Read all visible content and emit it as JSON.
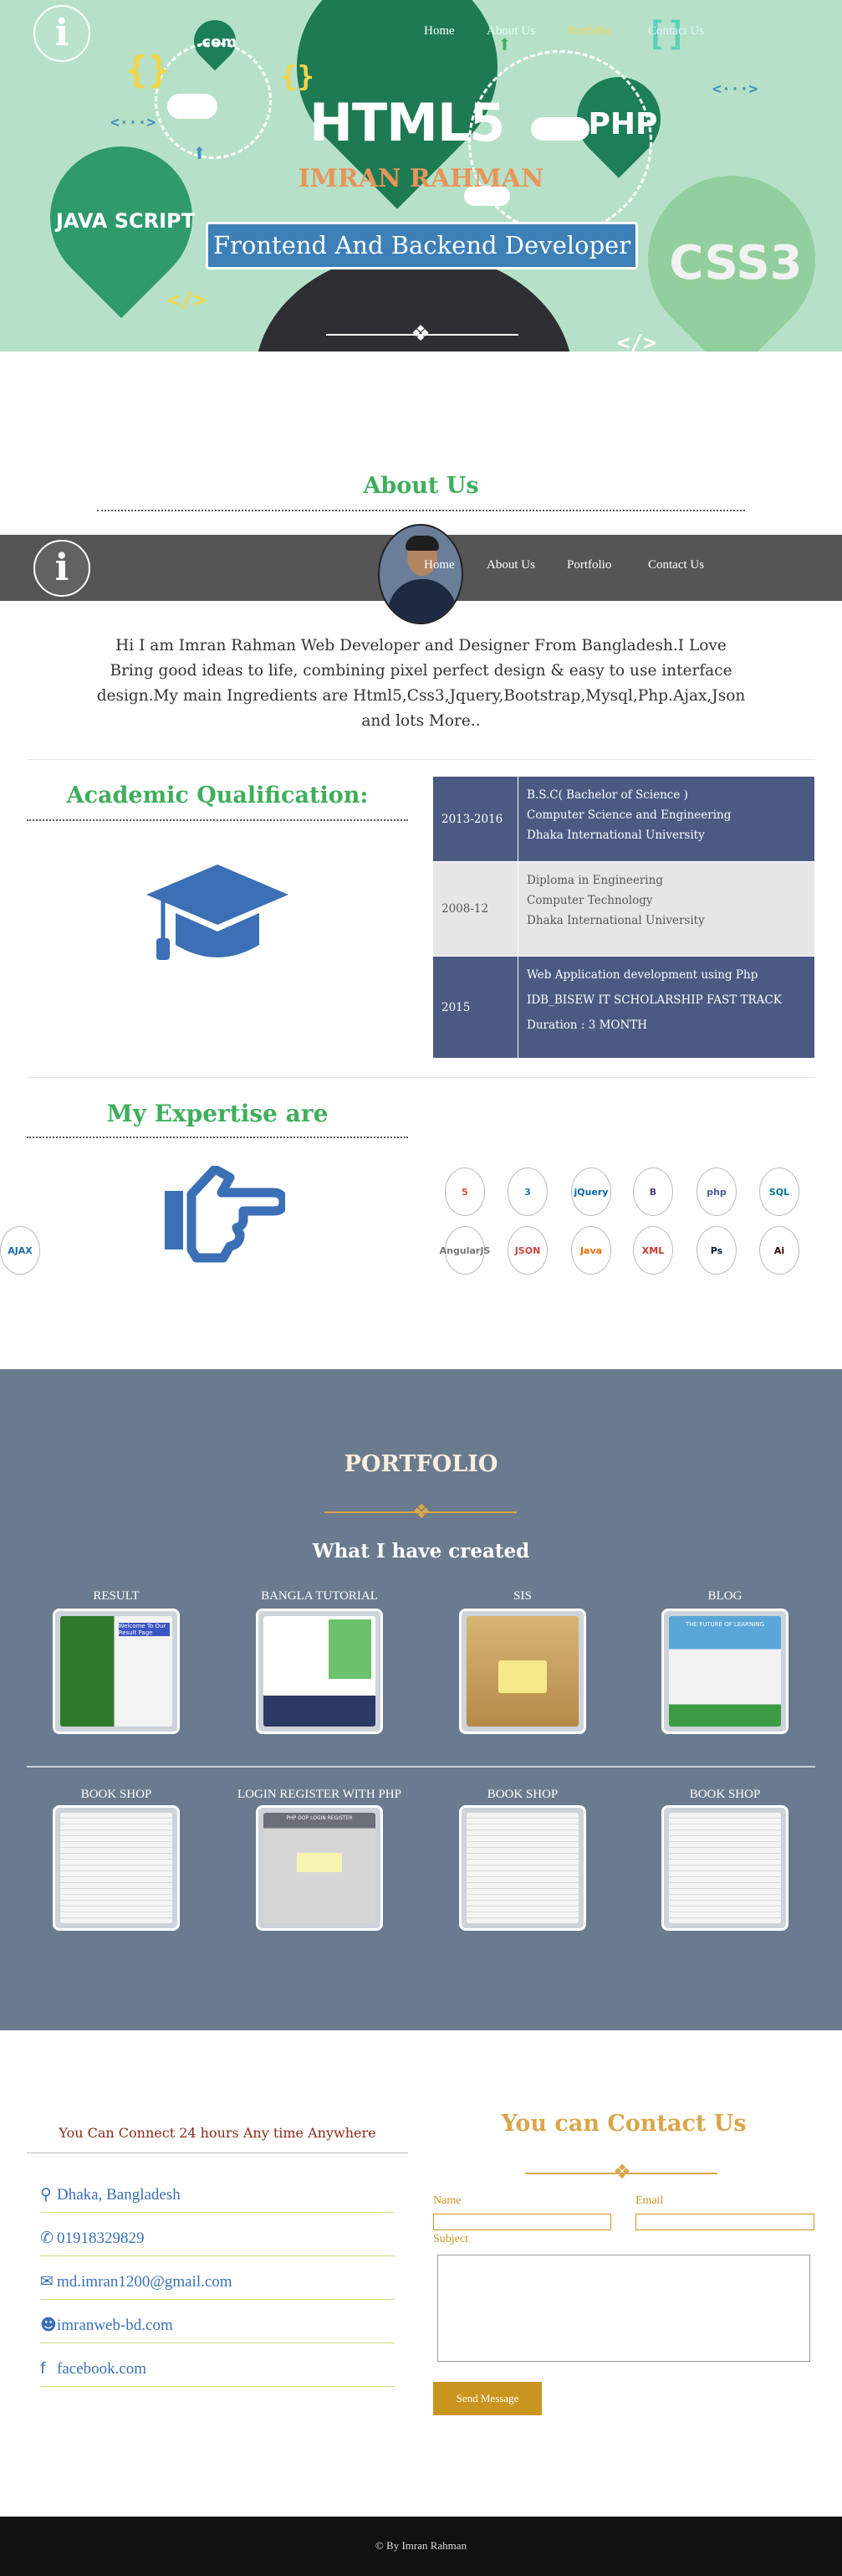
{
  "nav": {
    "items": [
      "Home",
      "About Us",
      "Portfolio",
      "Contact Us"
    ]
  },
  "logo": {
    "glyph": "i"
  },
  "hero": {
    "name": "IMRAN RAHMAN",
    "tagline": "Frontend And Backend Developer",
    "balloons": [
      "HTML5",
      "PHP",
      "JAVA SCRIPT",
      "CSS3",
      ".com"
    ]
  },
  "about": {
    "title": "About Us",
    "text": "Hi I am Imran Rahman Web Developer and Designer From Bangladesh.I Love Bring good ideas to life, combining pixel perfect design & easy to use interface design.My main Ingredients are Html5,Css3,Jquery,Bootstrap,Mysql,Php.Ajax,Json and lots More.."
  },
  "qualification": {
    "title": "Academic Qualification:",
    "rows": [
      {
        "year": "2013-2016",
        "lines": [
          "B.S.C( Bachelor of Science )",
          "Computer Science and Engineering",
          "Dhaka International University"
        ],
        "bg": "#4a5a82",
        "fg": "#ffffff"
      },
      {
        "year": "2008-12",
        "lines": [
          "Diploma in Engineering",
          "Computer Technology",
          "Dhaka International University"
        ],
        "bg": "#e6e6e6",
        "fg": "#555555"
      },
      {
        "year": "2015",
        "lines": [
          "Web Application development using Php",
          "IDB_BISEW IT SCHOLARSHIP FAST TRACK",
          "Duration :  3 MONTH"
        ],
        "bg": "#4a5a82",
        "fg": "#ffffff"
      }
    ]
  },
  "expertise": {
    "title": "My Expertise are",
    "icons": [
      "html5-icon",
      "css3-icon",
      "jquery-icon",
      "bootstrap-icon",
      "php-icon",
      "mysql-icon",
      "angularjs-icon",
      "json-icon",
      "java-icon",
      "xml-icon",
      "photoshop-icon",
      "illustrator-icon",
      "ajax-icon"
    ],
    "icon_labels": [
      "5",
      "3",
      "jQuery",
      "B",
      "php",
      "SQL",
      "AngularJS",
      "JSON",
      "Java",
      "XML",
      "Ps",
      "Ai",
      "AJAX"
    ]
  },
  "portfolio": {
    "title": "PORTFOLIO",
    "subtitle": "What I have created",
    "row1": [
      "RESULT",
      "BANGLA TUTORIAL",
      "SIS",
      "BLOG"
    ],
    "row2": [
      "BOOK SHOP",
      "LOGIN REGISTER WITH PHP",
      "BOOK SHOP",
      "BOOK SHOP"
    ],
    "thumb_texts": {
      "result": "Welcome To Our Result Page",
      "login": "PHP OOP LOGIN REGISTER",
      "blog": "THE FUTURE OF LEARNING"
    }
  },
  "contact": {
    "connect": "You Can Connect 24 hours Any time Anywhere",
    "title": "You can Contact Us",
    "items": [
      {
        "icon": "map-marker-icon",
        "text": "Dhaka, Bangladesh"
      },
      {
        "icon": "phone-icon",
        "text": "01918329829"
      },
      {
        "icon": "envelope-icon",
        "text": "md.imran1200@gmail.com"
      },
      {
        "icon": "user-icon",
        "text": "imranweb-bd.com"
      },
      {
        "icon": "facebook-icon",
        "text": "facebook.com"
      }
    ],
    "labels": {
      "name": "Name",
      "email": "Email",
      "subject": "Subject"
    },
    "button": "Send Message"
  },
  "footer": {
    "text": "© By Imran Rahman"
  },
  "colors": {
    "hero_bg": "#b6e1c8",
    "green": "#3fae5c",
    "gold": "#c9951e",
    "navy": "#4a5a82",
    "portfolio_bg": "#6b7b8f",
    "blue": "#3b6fb6",
    "name_orange": "#e8955a"
  }
}
